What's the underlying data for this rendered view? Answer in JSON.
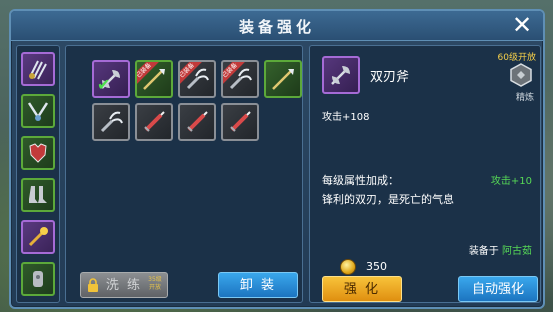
{
  "window": {
    "title": "装备强化"
  },
  "slots": [
    {
      "icon": "triple-claw-icon",
      "rarity": "purple"
    },
    {
      "icon": "necklace-icon",
      "rarity": "green"
    },
    {
      "icon": "armor-icon",
      "rarity": "green"
    },
    {
      "icon": "boots-icon",
      "rarity": "green"
    },
    {
      "icon": "scepter-icon",
      "rarity": "purple"
    },
    {
      "icon": "charm-icon",
      "rarity": "green"
    }
  ],
  "inventory": [
    {
      "icon": "twin-axe-icon",
      "rarity": "purple",
      "equipped_mark": "✔",
      "tag": ""
    },
    {
      "icon": "spear-icon",
      "rarity": "green",
      "tag": "已装备"
    },
    {
      "icon": "claw-icon",
      "rarity": "gray",
      "tag": "已装备"
    },
    {
      "icon": "claw-icon",
      "rarity": "gray",
      "tag": "已装备"
    },
    {
      "icon": "spear-icon",
      "rarity": "green",
      "tag": ""
    },
    {
      "icon": "claw-icon",
      "rarity": "gray",
      "tag": ""
    },
    {
      "icon": "sword-icon",
      "rarity": "gray",
      "tag": ""
    },
    {
      "icon": "sword-icon",
      "rarity": "gray",
      "tag": ""
    },
    {
      "icon": "sword-icon",
      "rarity": "gray",
      "tag": ""
    }
  ],
  "buttons": {
    "wash": "洗 练",
    "wash_note": "35级开放",
    "unequip": "卸 装",
    "enhance": "强 化",
    "auto_enhance": "自动强化"
  },
  "detail": {
    "name": "双刃斧",
    "unlock": "60级开放",
    "refine_label": "精炼",
    "stat": "攻击+108",
    "bonus_label": "每级属性加成：",
    "bonus_value": "攻击+10",
    "description": "锋利的双刃，是死亡的气息",
    "equipped_prefix": "装备于",
    "equipped_name": "阿古茹",
    "cost": "350"
  },
  "colors": {
    "purple": "#a56bd6",
    "green": "#5ca93a",
    "gray": "#8a8f96",
    "accent_green": "#56d856",
    "gold": "#f6d04a"
  }
}
